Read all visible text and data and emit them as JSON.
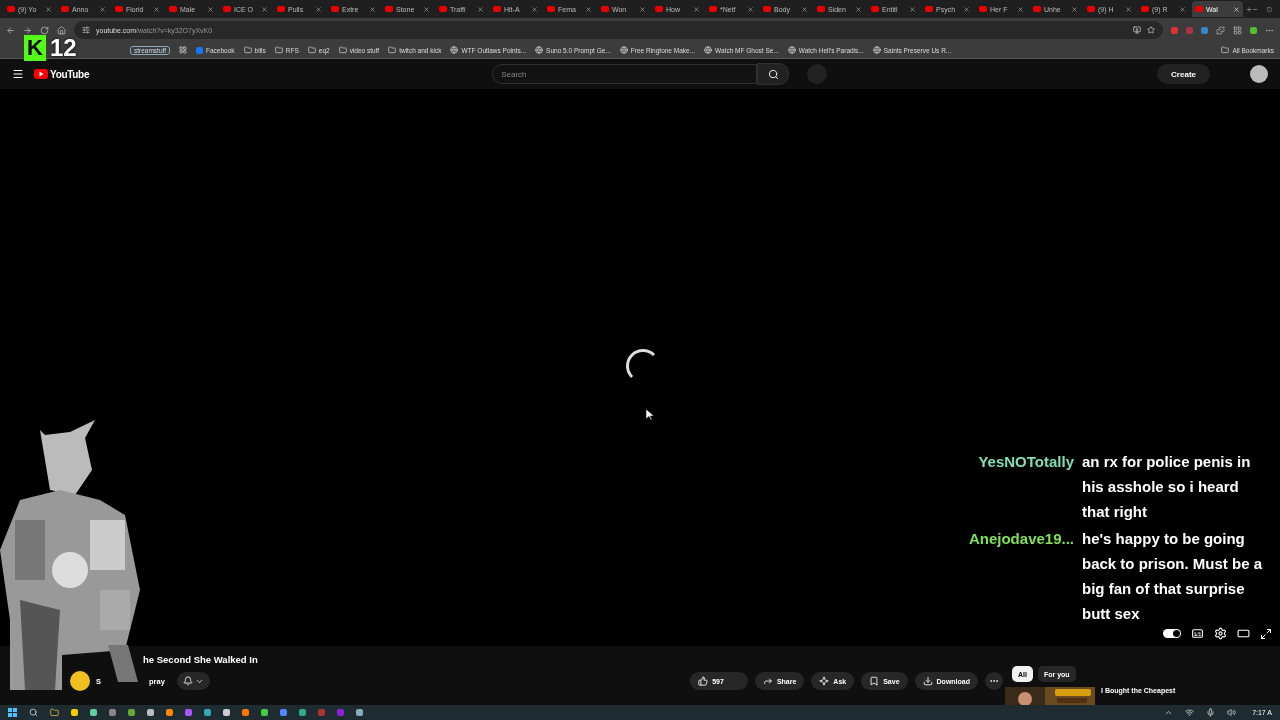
{
  "tabs": [
    {
      "label": "(9) Yo",
      "selected": false
    },
    {
      "label": "Anno",
      "selected": false
    },
    {
      "label": "Florid",
      "selected": false
    },
    {
      "label": "Male",
      "selected": false
    },
    {
      "label": "ICE O",
      "selected": false
    },
    {
      "label": "Pulls",
      "selected": false
    },
    {
      "label": "Extre",
      "selected": false
    },
    {
      "label": "Stone",
      "selected": false
    },
    {
      "label": "Traffi",
      "selected": false
    },
    {
      "label": "Hit-A",
      "selected": false
    },
    {
      "label": "Fema",
      "selected": false
    },
    {
      "label": "Won",
      "selected": false
    },
    {
      "label": "How",
      "selected": false
    },
    {
      "label": "*Netf",
      "selected": false
    },
    {
      "label": "Body",
      "selected": false
    },
    {
      "label": "Siden",
      "selected": false
    },
    {
      "label": "Entitl",
      "selected": false
    },
    {
      "label": "Psych",
      "selected": false
    },
    {
      "label": "Her F",
      "selected": false
    },
    {
      "label": "Unhe",
      "selected": false
    },
    {
      "label": "(9) H",
      "selected": false
    },
    {
      "label": "(9) R",
      "selected": false
    },
    {
      "label": "Wal",
      "selected": true
    }
  ],
  "address": {
    "host": "youtube.com",
    "path": "/watch?v=ky32O7yXvK0"
  },
  "overlay_logo": {
    "letter": "K",
    "number": "12"
  },
  "bookmarks": [
    {
      "label": "streamstuff",
      "kind": "chip"
    },
    {
      "label": "Facebook",
      "kind": "facebook"
    },
    {
      "label": "bills",
      "kind": "folder"
    },
    {
      "label": "RFS",
      "kind": "folder"
    },
    {
      "label": "eq2",
      "kind": "folder"
    },
    {
      "label": "video stuff",
      "kind": "folder"
    },
    {
      "label": "twitch and kick",
      "kind": "folder"
    },
    {
      "label": "WTF Outlaws Points...",
      "kind": "site"
    },
    {
      "label": "Suno 5.0 Prompt Ge...",
      "kind": "site"
    },
    {
      "label": "Free Ringtone Make...",
      "kind": "site"
    },
    {
      "label": "Watch MF Ghost Se...",
      "kind": "site"
    },
    {
      "label": "Watch Hell's Paradis...",
      "kind": "site"
    },
    {
      "label": "Saints Preserve Us R...",
      "kind": "site"
    }
  ],
  "all_bookmarks": "All Bookmarks",
  "header": {
    "logo": "YouTube",
    "search_placeholder": "Search",
    "create": "Create"
  },
  "chat": [
    {
      "name": "YesNOTotally",
      "color": "#7fe0b8",
      "message": "an rx for police penis in his asshole so i heard that right"
    },
    {
      "name": "Anejodave19...",
      "color": "#7ee05a",
      "message": "he's happy to be going back to prison. Must be a big fan of that surprise butt sex"
    }
  ],
  "video": {
    "title": "he Second She Walked In",
    "channel_start": "S",
    "channel_end": "pray"
  },
  "actions": {
    "likes": "597",
    "share": "Share",
    "ask": "Ask",
    "save": "Save",
    "download": "Download"
  },
  "chips": [
    {
      "label": "All",
      "selected": true
    },
    {
      "label": "For you",
      "selected": false
    }
  ],
  "recommended": {
    "title": "I Bought the Cheapest"
  },
  "clock": "7:17 A",
  "autoplay": {
    "on": true
  }
}
